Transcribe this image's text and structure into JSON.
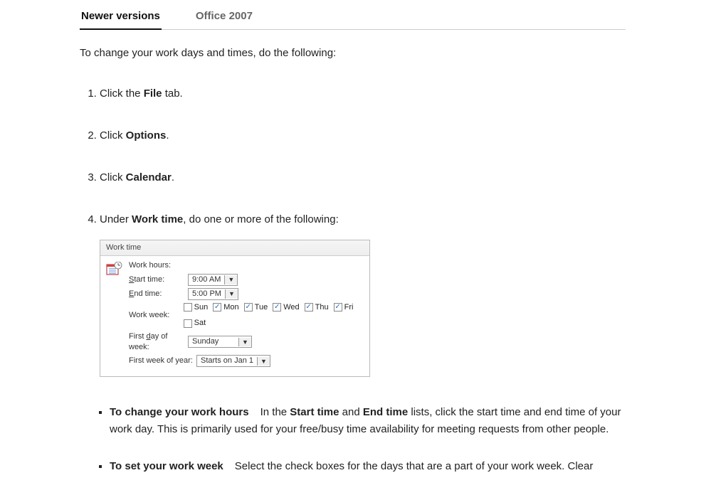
{
  "tabs": {
    "newer": "Newer versions",
    "office2007": "Office 2007"
  },
  "intro": "To change your work days and times, do the following:",
  "steps": {
    "s1_a": "Click the ",
    "s1_b": "File",
    "s1_c": " tab.",
    "s2_a": "Click ",
    "s2_b": "Options",
    "s2_c": ".",
    "s3_a": "Click ",
    "s3_b": "Calendar",
    "s3_c": ".",
    "s4_a": "Under ",
    "s4_b": "Work time",
    "s4_c": ", do one or more of the following:"
  },
  "worktime": {
    "header": "Work time",
    "work_hours": "Work hours:",
    "start_label_a": "S",
    "start_label_b": "tart time:",
    "start_value": "9:00 AM",
    "end_label_a": "E",
    "end_label_b": "nd time:",
    "end_value": "5:00 PM",
    "workweek_label": "Work week:",
    "days": {
      "sun": {
        "label": "Sun",
        "checked": false
      },
      "mon": {
        "label": "Mon",
        "checked": true
      },
      "tue": {
        "label": "Tue",
        "checked": true
      },
      "wed": {
        "label": "Wed",
        "checked": true
      },
      "thu": {
        "label": "Thu",
        "checked": true
      },
      "fri": {
        "label": "Fri",
        "checked": true
      },
      "sat": {
        "label": "Sat",
        "checked": false
      }
    },
    "first_day_label_a": "First ",
    "first_day_label_b": "d",
    "first_day_label_c": "ay of week:",
    "first_day_value": "Sunday",
    "first_week_label": "First week of year:",
    "first_week_value": "Starts on Jan 1"
  },
  "bullets": {
    "b1_title": "To change your work hours",
    "b1_a": "In the ",
    "b1_b": "Start time",
    "b1_c": " and ",
    "b1_d": "End time",
    "b1_e": " lists, click the start time and end time of your work day. This is primarily used for your free/busy time availability for meeting requests from other people.",
    "b2_title": "To set your work week",
    "b2_rest": "Select the check boxes for the days that are a part of your work week. Clear"
  }
}
